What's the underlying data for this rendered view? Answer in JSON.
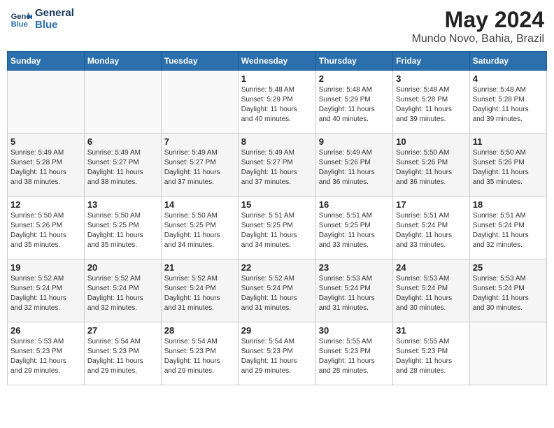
{
  "header": {
    "logo_line1": "General",
    "logo_line2": "Blue",
    "main_title": "May 2024",
    "subtitle": "Mundo Novo, Bahia, Brazil"
  },
  "days_of_week": [
    "Sunday",
    "Monday",
    "Tuesday",
    "Wednesday",
    "Thursday",
    "Friday",
    "Saturday"
  ],
  "weeks": [
    [
      {
        "day": "",
        "info": ""
      },
      {
        "day": "",
        "info": ""
      },
      {
        "day": "",
        "info": ""
      },
      {
        "day": "1",
        "info": "Sunrise: 5:48 AM\nSunset: 5:29 PM\nDaylight: 11 hours\nand 40 minutes."
      },
      {
        "day": "2",
        "info": "Sunrise: 5:48 AM\nSunset: 5:29 PM\nDaylight: 11 hours\nand 40 minutes."
      },
      {
        "day": "3",
        "info": "Sunrise: 5:48 AM\nSunset: 5:28 PM\nDaylight: 11 hours\nand 39 minutes."
      },
      {
        "day": "4",
        "info": "Sunrise: 5:48 AM\nSunset: 5:28 PM\nDaylight: 11 hours\nand 39 minutes."
      }
    ],
    [
      {
        "day": "5",
        "info": "Sunrise: 5:49 AM\nSunset: 5:28 PM\nDaylight: 11 hours\nand 38 minutes."
      },
      {
        "day": "6",
        "info": "Sunrise: 5:49 AM\nSunset: 5:27 PM\nDaylight: 11 hours\nand 38 minutes."
      },
      {
        "day": "7",
        "info": "Sunrise: 5:49 AM\nSunset: 5:27 PM\nDaylight: 11 hours\nand 37 minutes."
      },
      {
        "day": "8",
        "info": "Sunrise: 5:49 AM\nSunset: 5:27 PM\nDaylight: 11 hours\nand 37 minutes."
      },
      {
        "day": "9",
        "info": "Sunrise: 5:49 AM\nSunset: 5:26 PM\nDaylight: 11 hours\nand 36 minutes."
      },
      {
        "day": "10",
        "info": "Sunrise: 5:50 AM\nSunset: 5:26 PM\nDaylight: 11 hours\nand 36 minutes."
      },
      {
        "day": "11",
        "info": "Sunrise: 5:50 AM\nSunset: 5:26 PM\nDaylight: 11 hours\nand 35 minutes."
      }
    ],
    [
      {
        "day": "12",
        "info": "Sunrise: 5:50 AM\nSunset: 5:26 PM\nDaylight: 11 hours\nand 35 minutes."
      },
      {
        "day": "13",
        "info": "Sunrise: 5:50 AM\nSunset: 5:25 PM\nDaylight: 11 hours\nand 35 minutes."
      },
      {
        "day": "14",
        "info": "Sunrise: 5:50 AM\nSunset: 5:25 PM\nDaylight: 11 hours\nand 34 minutes."
      },
      {
        "day": "15",
        "info": "Sunrise: 5:51 AM\nSunset: 5:25 PM\nDaylight: 11 hours\nand 34 minutes."
      },
      {
        "day": "16",
        "info": "Sunrise: 5:51 AM\nSunset: 5:25 PM\nDaylight: 11 hours\nand 33 minutes."
      },
      {
        "day": "17",
        "info": "Sunrise: 5:51 AM\nSunset: 5:24 PM\nDaylight: 11 hours\nand 33 minutes."
      },
      {
        "day": "18",
        "info": "Sunrise: 5:51 AM\nSunset: 5:24 PM\nDaylight: 11 hours\nand 32 minutes."
      }
    ],
    [
      {
        "day": "19",
        "info": "Sunrise: 5:52 AM\nSunset: 5:24 PM\nDaylight: 11 hours\nand 32 minutes."
      },
      {
        "day": "20",
        "info": "Sunrise: 5:52 AM\nSunset: 5:24 PM\nDaylight: 11 hours\nand 32 minutes."
      },
      {
        "day": "21",
        "info": "Sunrise: 5:52 AM\nSunset: 5:24 PM\nDaylight: 11 hours\nand 31 minutes."
      },
      {
        "day": "22",
        "info": "Sunrise: 5:52 AM\nSunset: 5:24 PM\nDaylight: 11 hours\nand 31 minutes."
      },
      {
        "day": "23",
        "info": "Sunrise: 5:53 AM\nSunset: 5:24 PM\nDaylight: 11 hours\nand 31 minutes."
      },
      {
        "day": "24",
        "info": "Sunrise: 5:53 AM\nSunset: 5:24 PM\nDaylight: 11 hours\nand 30 minutes."
      },
      {
        "day": "25",
        "info": "Sunrise: 5:53 AM\nSunset: 5:24 PM\nDaylight: 11 hours\nand 30 minutes."
      }
    ],
    [
      {
        "day": "26",
        "info": "Sunrise: 5:53 AM\nSunset: 5:23 PM\nDaylight: 11 hours\nand 29 minutes."
      },
      {
        "day": "27",
        "info": "Sunrise: 5:54 AM\nSunset: 5:23 PM\nDaylight: 11 hours\nand 29 minutes."
      },
      {
        "day": "28",
        "info": "Sunrise: 5:54 AM\nSunset: 5:23 PM\nDaylight: 11 hours\nand 29 minutes."
      },
      {
        "day": "29",
        "info": "Sunrise: 5:54 AM\nSunset: 5:23 PM\nDaylight: 11 hours\nand 29 minutes."
      },
      {
        "day": "30",
        "info": "Sunrise: 5:55 AM\nSunset: 5:23 PM\nDaylight: 11 hours\nand 28 minutes."
      },
      {
        "day": "31",
        "info": "Sunrise: 5:55 AM\nSunset: 5:23 PM\nDaylight: 11 hours\nand 28 minutes."
      },
      {
        "day": "",
        "info": ""
      }
    ]
  ]
}
